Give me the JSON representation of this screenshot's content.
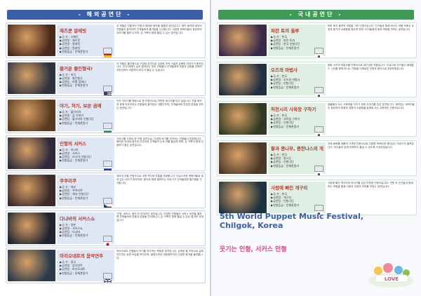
{
  "left": {
    "header": "- 해외공연단 -",
    "items": [
      {
        "title": "재즈쿤 알레빗",
        "meta": [
          "▶국 가 : 스페인",
          "▶공연명 : 재즈쿤",
          "▶공연명 : 알레빗",
          "▶공연팀 : 알레빗",
          "▶연령등급 : 전체관람가"
        ],
        "flag": "spain",
        "desc": "이 작품은 전통적인 인형극 형태와 음악을 결합한 공연입니다. 재즈 음악에 맞추어 인형들이 움직이며 관객들에게 즐거움을 선사합니다. 다양한 캐릭터들이 등장하여 이야기를 펼쳐 나가며, 온 가족이 함께 즐길 수 있는 공연입니다."
      },
      {
        "title": "즐거운 줄인형극!",
        "meta": [
          "▶국 가 : 미국",
          "▶공연명 : 줄인형극",
          "▶공연팀 : 퍼펫 컴퍼니",
          "▶연령등급 : 전체관람가"
        ],
        "flag": "usa",
        "desc": "이 작품은 줄인형으로 구성된 공연으로 섬세한 조작 기술과 유쾌한 이야기가 돋보입니다. 무대 위에서 살아 움직이는 듯한 인형들이 관객들에게 웃음과 감동을 전하며, 어린이부터 어른까지 모두가 즐길 수 있습니다."
      },
      {
        "title": "야기, 처기, 보은 곰에",
        "meta": [
          "▶국 가 : 불가리아",
          "▶공연명 : 곰 이야기",
          "▶공연팀 : 불가리아 인형극단",
          "▶연령등급 : 전체관람가"
        ],
        "flag": "bulgaria",
        "desc": "민속 이야기를 바탕으로 한 인형극으로 따뜻한 메시지를 담고 있습니다. 전통 음악과 함께 어우러지는 인형들의 움직임이 아름다우며, 관객들에게 잔잔한 감동을 전하는 공연입니다."
      },
      {
        "title": "인형의 서커스",
        "meta": [
          "▶국 가 : 러시아",
          "▶공연명 : 서커스",
          "▶공연팀 : 러시아 인형극단",
          "▶연령등급 : 전체관람가"
        ],
        "flag": "russia",
        "desc": "서커스를 주제로 한 인형 공연으로, 다양한 묘기를 선보이는 인형들이 등장합니다. 화려한 무대와 음악이 어우러져 관객들의 눈과 귀를 즐겁게 하며, 온 가족이 함께 관람하기 좋은 공연입니다."
      },
      {
        "title": "쿠쿠리쿠",
        "meta": [
          "▶국 가 : 체코",
          "▶공연명 : 쿠쿠리쿠",
          "▶공연팀 : 체코 인형극단",
          "▶연령등급 : 전체관람가"
        ],
        "flag": "czech",
        "desc": "체코의 전통 인형극으로 오랜 역사와 전통을 자랑합니다. 익살스러운 캐릭터들과 재치 있는 대사가 돋보이며, 음악과 함께 펼쳐지는 이야기가 관객들에게 즐거움을 선사합니다."
      },
      {
        "title": "다냐바의 서커스쇼",
        "meta": [
          "▶국 가 : 일본",
          "▶공연명 : 서커스쇼",
          "▶공연팀 : 다냐바",
          "▶연령등급 : 전체관람가"
        ],
        "flag": "japan",
        "desc": "'인형, 써커스, 음악'이 어우러진 공연입니다. 다양한 인형들이 서커스 공연을 펼치며 관객들에게 웃음과 감동을 선사합니다. 온 가족이 함께 즐길 수 있는 흥겨운 무대입니다."
      },
      {
        "title": "마리오네트의 음악연주",
        "meta": [
          "▶국 가 : 영국",
          "▶공연명 : 음악연주",
          "▶공연팀 : 마리오네트",
          "▶연령등급 : 전체관람가"
        ],
        "flag": "uk",
        "desc": "마리오네트 인형들이 악기를 연주하는 독특한 공연입니다. 섬세한 줄 조작으로 실제 연주하는 듯한 모습을 보여주며, 클래식부터 대중음악까지 다양한 음악을 들려줍니다."
      }
    ]
  },
  "right": {
    "header": "- 국내공연단 -",
    "items": [
      {
        "title": "파란 토끼 올루",
        "meta": [
          "▶국 가 : 한국",
          "▶공연명 : 파란 토끼",
          "▶공연팀 : 한국 인형극단",
          "▶연령등급 : 전체관람가"
        ],
        "flag": "korea",
        "desc": "파란 토끼 올루의 모험을 그린 인형극입니다. 친구들과 함께 떠나는 여행 속에서 우정과 용기의 소중함을 배우게 되며, 아이들에게 꿈과 희망을 전하는 공연입니다."
      },
      {
        "title": "오즈의 마법사",
        "meta": [
          "▶국 가 : 한국",
          "▶공연명 : 오즈의 마법사",
          "▶공연팀 : 인형극단",
          "▶연령등급 : 전체관람가"
        ],
        "flag": "korea",
        "desc": "동화 오즈의 마법사를 인형극으로 재구성한 작품입니다. 도로시와 친구들이 에메랄드 시티를 향해 떠나는 여정을 다채로운 인형과 음악으로 표현하였습니다."
      },
      {
        "title": "허전시리 사육장 구하기",
        "meta": [
          "▶국 가 : 한국",
          "▶공연명 : 사육장 구하기",
          "▶공연팀 : 인형극단",
          "▶연령등급 : 전체관람가"
        ],
        "flag": "korea",
        "desc": "동물들이 사는 사육장을 지키기 위한 이야기를 담은 공연입니다. 재미있는 캐릭터들이 등장하여 환경과 생명의 소중함을 일깨워 주는 교육적인 인형극입니다."
      },
      {
        "title": "팥과 콩나무, 콩한나스의 개",
        "meta": [
          "▶국 가 : 한국",
          "▶공연명 : 콩나무",
          "▶공연팀 : 인형극단",
          "▶연령등급 : 전체관람가"
        ],
        "flag": "korea",
        "desc": "전래 동화를 새롭게 각색한 인형극으로 다양한 캐릭터와 재미있는 이야기가 펼쳐집니다. 아이들이 쉽게 이해하고 즐길 수 있도록 구성되었습니다."
      },
      {
        "title": "사랑에 빠진 개구리",
        "meta": [
          "▶국 가 : 한국",
          "▶공연명 : 개구리",
          "▶공연팀 : 인형극단",
          "▶연령등급 : 전체관람가"
        ],
        "flag": "korea",
        "desc": "사랑에 빠진 개구리의 이야기를 담은 따뜻한 인형극입니다. 연못 속 친구들과 함께하는 모험을 통해 사랑과 우정의 의미를 전하는 공연입니다."
      }
    ],
    "festival_title": [
      "5th World Puppet Music Festival,",
      "Chilgok, Korea"
    ],
    "tagline": "웃기는 인형, 서커스 인형",
    "mascot_label": "LOVE"
  },
  "colors": {
    "left_accent": "#3b5fa8",
    "right_accent": "#3e9a55",
    "title_red": "#c0392b",
    "tagline": "#e0458a"
  }
}
